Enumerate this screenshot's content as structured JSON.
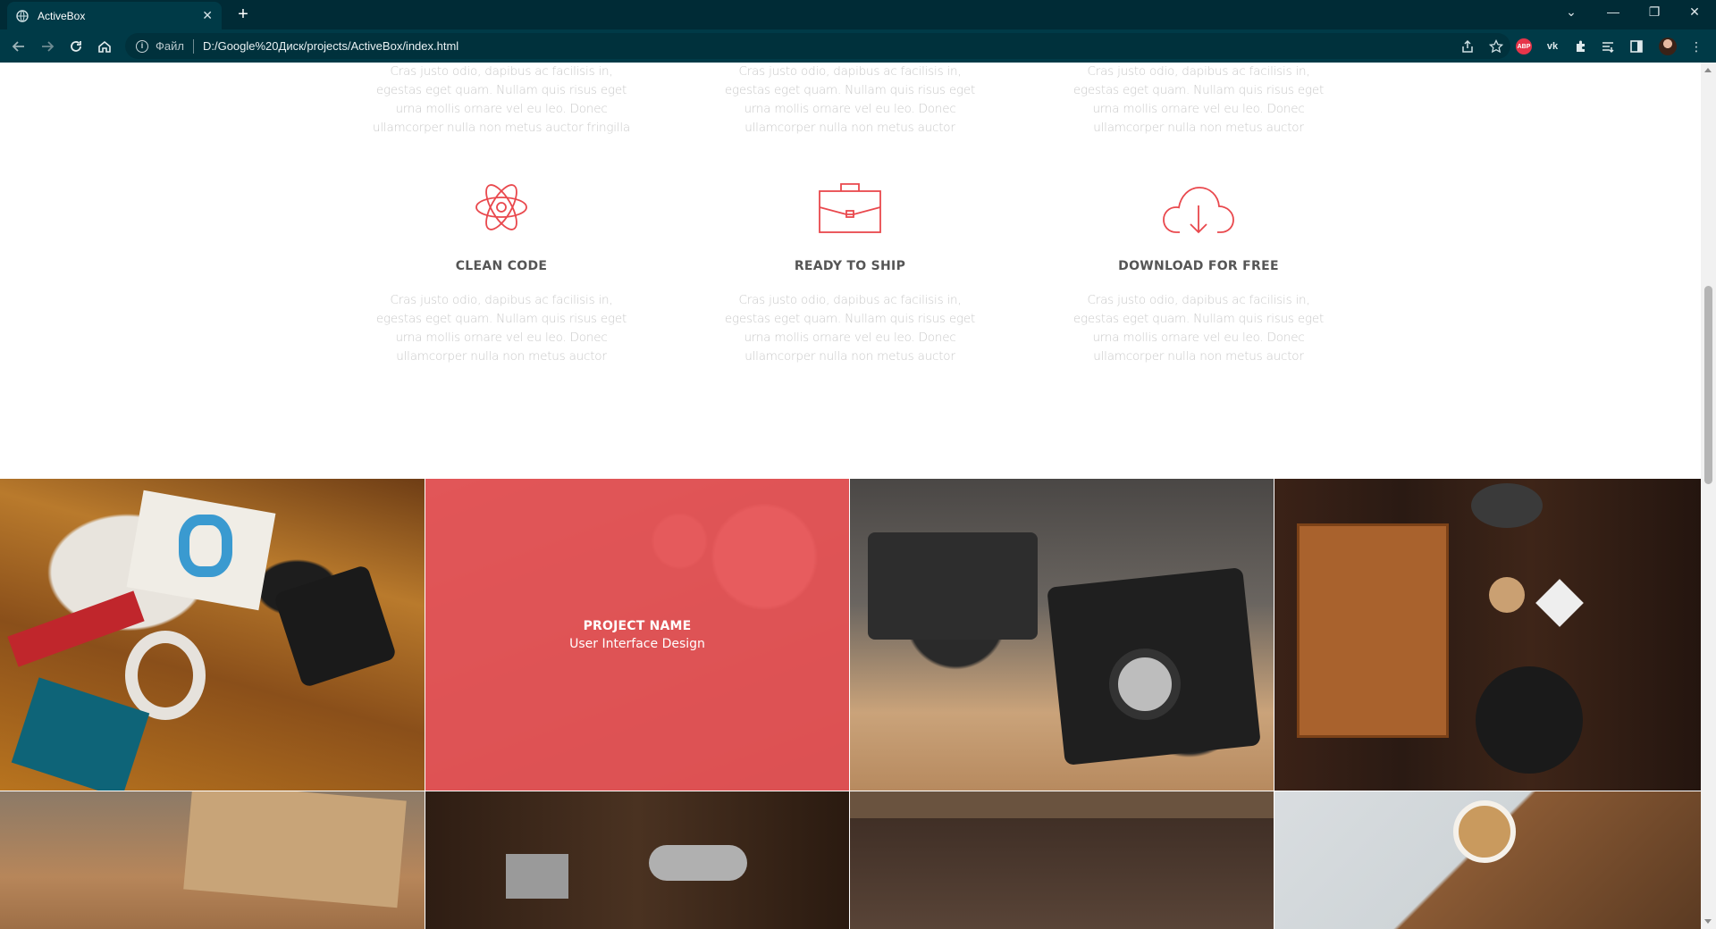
{
  "browser": {
    "tab_title": "ActiveBox",
    "address_scheme": "Файл",
    "address_url": "D:/Google%20Диск/projects/ActiveBox/index.html",
    "abp_label": "ABP"
  },
  "features_top": [
    {
      "text": "Cras justo odio, dapibus ac facilisis in, egestas eget quam. Nullam quis risus eget urna mollis ornare vel eu leo. Donec ullamcorper nulla non metus auctor fringilla"
    },
    {
      "text": "Cras justo odio, dapibus ac facilisis in, egestas eget quam. Nullam quis risus eget urna mollis ornare vel eu leo. Donec ullamcorper nulla non metus auctor"
    },
    {
      "text": "Cras justo odio, dapibus ac facilisis in, egestas eget quam. Nullam quis risus eget urna mollis ornare vel eu leo. Donec ullamcorper nulla non metus auctor"
    }
  ],
  "features": [
    {
      "icon": "atom-icon",
      "title": "CLEAN CODE",
      "text": "Cras justo odio, dapibus ac facilisis in, egestas eget quam. Nullam quis risus eget urna mollis ornare vel eu leo. Donec ullamcorper nulla non metus auctor"
    },
    {
      "icon": "briefcase-icon",
      "title": "READY TO SHIP",
      "text": "Cras justo odio, dapibus ac facilisis in, egestas eget quam. Nullam quis risus eget urna mollis ornare vel eu leo. Donec ullamcorper nulla non metus auctor"
    },
    {
      "icon": "cloud-download-icon",
      "title": "DOWNLOAD FOR FREE",
      "text": "Cras justo odio, dapibus ac facilisis in, egestas eget quam. Nullam quis risus eget urna mollis ornare vel eu leo. Donec ullamcorper nulla non metus auctor"
    }
  ],
  "portfolio": {
    "hover_project_name": "PROJECT NAME",
    "hover_project_category": "User Interface Design"
  },
  "colors": {
    "accent": "#e9484d",
    "chrome": "#003a47"
  }
}
